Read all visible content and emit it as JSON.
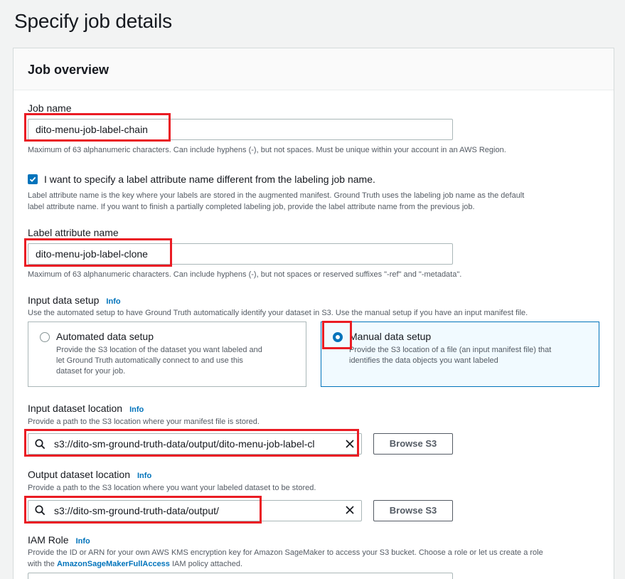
{
  "page": {
    "title": "Specify job details"
  },
  "job_overview": {
    "title": "Job overview",
    "job_name": {
      "label": "Job name",
      "value": "dito-menu-job-label-chain",
      "constraint": "Maximum of 63 alphanumeric characters. Can include hyphens (-), but not spaces. Must be unique within your account in an AWS Region."
    },
    "label_attr_checkbox": {
      "checked": true,
      "label": "I want to specify a label attribute name different from the labeling job name.",
      "description_line1": "Label attribute name is the key where your labels are stored in the augmented manifest. Ground Truth uses the labeling job name as the default",
      "description_line2": "label attribute name. If you want to finish a partially completed labeling job, provide the label attribute name from the previous job."
    },
    "label_attribute_name": {
      "label": "Label attribute name",
      "value": "dito-menu-job-label-clone",
      "constraint": "Maximum of 63 alphanumeric characters. Can include hyphens (-), but not spaces or reserved suffixes \"-ref\" and \"-metadata\"."
    },
    "input_data_setup": {
      "label": "Input data setup",
      "info": "Info",
      "description": "Use the automated setup to have Ground Truth automatically identify your dataset in S3. Use the manual setup if you have an input manifest file.",
      "options": [
        {
          "title": "Automated data setup",
          "desc_line1": "Provide the S3 location of the dataset you want labeled and",
          "desc_line2": "let Ground Truth automatically connect to and use this",
          "desc_line3": "dataset for your job.",
          "selected": false
        },
        {
          "title": "Manual data setup",
          "desc_line1": "Provide the S3 location of a file (an input manifest file) that",
          "desc_line2": "identifies the data objects you want labeled",
          "selected": true
        }
      ]
    },
    "input_dataset_location": {
      "label": "Input dataset location",
      "info": "Info",
      "description": "Provide a path to the S3 location where your manifest file is stored.",
      "value": "s3://dito-sm-ground-truth-data/output/dito-menu-job-label-cl",
      "browse": "Browse S3"
    },
    "output_dataset_location": {
      "label": "Output dataset location",
      "info": "Info",
      "description": "Provide a path to the S3 location where you want your labeled dataset to be stored.",
      "value": "s3://dito-sm-ground-truth-data/output/",
      "browse": "Browse S3"
    },
    "iam_role": {
      "label": "IAM Role",
      "info": "Info",
      "description_line1": "Provide the ID or ARN for your own AWS KMS encryption key for Amazon SageMaker to access your S3 bucket. Choose a role or let us create a role",
      "description_prefix": "with the ",
      "policy_link": "AmazonSageMakerFullAccess",
      "description_suffix": " IAM policy attached."
    }
  },
  "colors": {
    "highlight": "#ea1c24",
    "accent": "#0073bb"
  }
}
